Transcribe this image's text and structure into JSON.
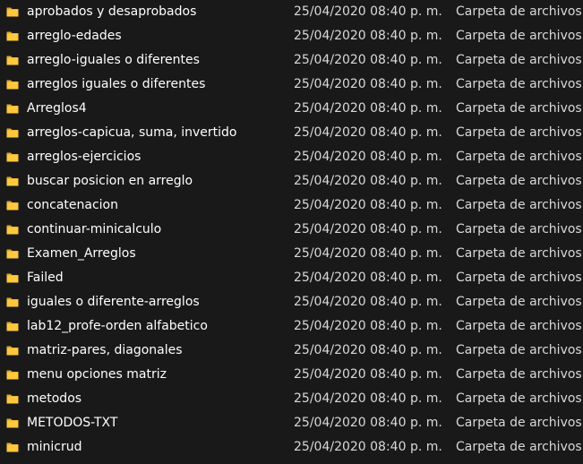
{
  "colors": {
    "background": "#191919",
    "text": "#ffffff",
    "folder": "#ffc83d"
  },
  "icon": "folder-icon",
  "files": [
    {
      "name": "aprobados y desaprobados",
      "date": "25/04/2020 08:40 p. m.",
      "type": "Carpeta de archivos"
    },
    {
      "name": "arreglo-edades",
      "date": "25/04/2020 08:40 p. m.",
      "type": "Carpeta de archivos"
    },
    {
      "name": "arreglo-iguales o diferentes",
      "date": "25/04/2020 08:40 p. m.",
      "type": "Carpeta de archivos"
    },
    {
      "name": "arreglos iguales o diferentes",
      "date": "25/04/2020 08:40 p. m.",
      "type": "Carpeta de archivos"
    },
    {
      "name": "Arreglos4",
      "date": "25/04/2020 08:40 p. m.",
      "type": "Carpeta de archivos"
    },
    {
      "name": "arreglos-capicua, suma, invertido",
      "date": "25/04/2020 08:40 p. m.",
      "type": "Carpeta de archivos"
    },
    {
      "name": "arreglos-ejercicios",
      "date": "25/04/2020 08:40 p. m.",
      "type": "Carpeta de archivos"
    },
    {
      "name": "buscar posicion en arreglo",
      "date": "25/04/2020 08:40 p. m.",
      "type": "Carpeta de archivos"
    },
    {
      "name": "concatenacion",
      "date": "25/04/2020 08:40 p. m.",
      "type": "Carpeta de archivos"
    },
    {
      "name": "continuar-minicalculo",
      "date": "25/04/2020 08:40 p. m.",
      "type": "Carpeta de archivos"
    },
    {
      "name": "Examen_Arreglos",
      "date": "25/04/2020 08:40 p. m.",
      "type": "Carpeta de archivos"
    },
    {
      "name": "Failed",
      "date": "25/04/2020 08:40 p. m.",
      "type": "Carpeta de archivos"
    },
    {
      "name": "iguales o diferente-arreglos",
      "date": "25/04/2020 08:40 p. m.",
      "type": "Carpeta de archivos"
    },
    {
      "name": "lab12_profe-orden alfabetico",
      "date": "25/04/2020 08:40 p. m.",
      "type": "Carpeta de archivos"
    },
    {
      "name": "matriz-pares, diagonales",
      "date": "25/04/2020 08:40 p. m.",
      "type": "Carpeta de archivos"
    },
    {
      "name": "menu opciones matriz",
      "date": "25/04/2020 08:40 p. m.",
      "type": "Carpeta de archivos"
    },
    {
      "name": "metodos",
      "date": "25/04/2020 08:40 p. m.",
      "type": "Carpeta de archivos"
    },
    {
      "name": "METODOS-TXT",
      "date": "25/04/2020 08:40 p. m.",
      "type": "Carpeta de archivos"
    },
    {
      "name": "minicrud",
      "date": "25/04/2020 08:40 p. m.",
      "type": "Carpeta de archivos"
    }
  ]
}
